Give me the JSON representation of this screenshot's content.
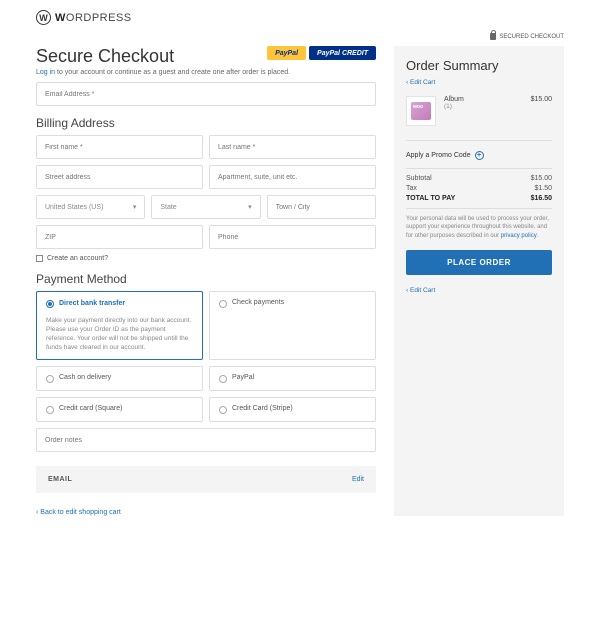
{
  "logo": {
    "mark": "W",
    "text_pre": "W",
    "text_post": "ORDPRESS"
  },
  "header": {
    "secured": "SECURED CHECKOUT"
  },
  "checkout": {
    "title": "Secure Checkout",
    "login_link": "Log in",
    "login_note": " to your account or continue as a guest and create one after order is placed.",
    "email_placeholder": "Email Address *",
    "billing_title": "Billing Address",
    "first_name": "First name *",
    "last_name": "Last name *",
    "street": "Street address",
    "apt": "Apartment, suite, unit etc.",
    "country": "United States (US)",
    "state": "State",
    "town": "Town / City",
    "zip": "ZIP",
    "phone": "Phone",
    "create_account": "Create an account?",
    "payment_title": "Payment Method",
    "order_notes": "Order notes",
    "email_bar_label": "EMAIL",
    "email_bar_edit": "Edit",
    "back_link": "Back to edit shopping cart"
  },
  "paypal": {
    "btn1": "PayPal",
    "btn2": "PayPal CREDIT"
  },
  "payments": {
    "opt1": {
      "label": "Direct bank transfer",
      "desc": "Make your payment directly into our bank account. Please use your Order ID as the payment reference. Your order will not be shipped untill the funds have cleared in our account."
    },
    "opt2": {
      "label": "Check payments"
    },
    "opt3": {
      "label": "Cash on delivery"
    },
    "opt4": {
      "label": "PayPal"
    },
    "opt5": {
      "label": "Credit card (Square)"
    },
    "opt6": {
      "label": "Credit Card (Stripe)"
    }
  },
  "summary": {
    "title": "Order Summary",
    "edit_cart": "Edit Cart",
    "item": {
      "name": "Album",
      "qty": "(1)",
      "price": "$15.00"
    },
    "promo": "Apply a Promo Code",
    "subtotal_label": "Subtotal",
    "subtotal_val": "$15.00",
    "tax_label": "Tax",
    "tax_val": "$1.50",
    "total_label": "TOTAL TO PAY",
    "total_val": "$16.50",
    "privacy_pre": "Your personal data will be used to process your order, support your experience throughout this website, and for other purposes described in our ",
    "privacy_link": "privacy policy",
    "place_order": "PLACE ORDER",
    "edit_cart_bottom": "Edit Cart"
  }
}
